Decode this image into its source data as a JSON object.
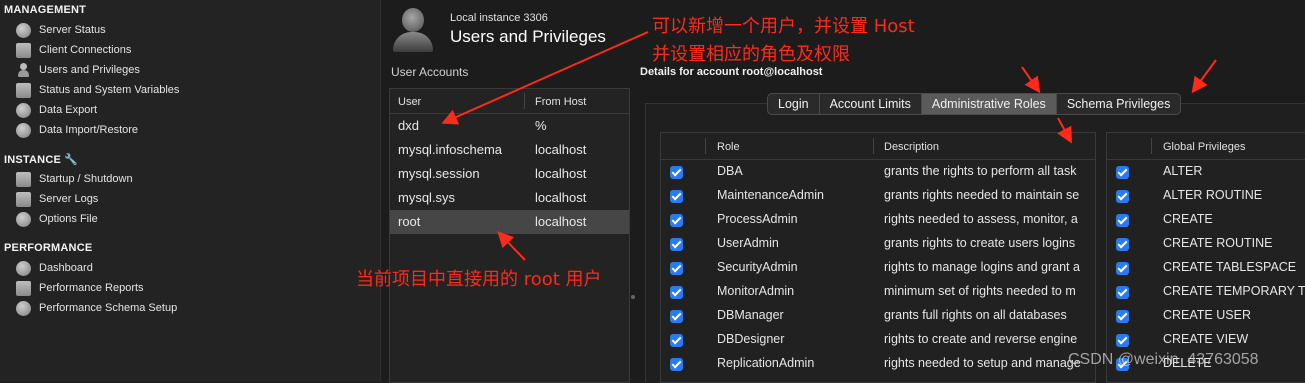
{
  "sidebar": {
    "management": {
      "heading": "MANAGEMENT",
      "items": [
        {
          "label": "Server Status",
          "icon": "server-status-icon"
        },
        {
          "label": "Client Connections",
          "icon": "client-connections-icon"
        },
        {
          "label": "Users and Privileges",
          "icon": "user-icon"
        },
        {
          "label": "Status and System Variables",
          "icon": "variables-icon"
        },
        {
          "label": "Data Export",
          "icon": "export-icon"
        },
        {
          "label": "Data Import/Restore",
          "icon": "import-icon"
        }
      ]
    },
    "instance": {
      "heading": "INSTANCE",
      "heading_icon": "wrench-icon",
      "items": [
        {
          "label": "Startup / Shutdown",
          "icon": "startup-icon"
        },
        {
          "label": "Server Logs",
          "icon": "logs-icon"
        },
        {
          "label": "Options File",
          "icon": "wrench-icon"
        }
      ]
    },
    "performance": {
      "heading": "PERFORMANCE",
      "items": [
        {
          "label": "Dashboard",
          "icon": "dashboard-icon"
        },
        {
          "label": "Performance Reports",
          "icon": "reports-icon"
        },
        {
          "label": "Performance Schema Setup",
          "icon": "schema-setup-icon"
        }
      ]
    }
  },
  "header": {
    "instance": "Local instance 3306",
    "title": "Users and Privileges"
  },
  "user_accounts": {
    "label": "User Accounts",
    "columns": [
      "User",
      "From Host"
    ],
    "rows": [
      {
        "user": "dxd",
        "host": "%"
      },
      {
        "user": "mysql.infoschema",
        "host": "localhost"
      },
      {
        "user": "mysql.session",
        "host": "localhost"
      },
      {
        "user": "mysql.sys",
        "host": "localhost"
      },
      {
        "user": "root",
        "host": "localhost",
        "selected": true
      }
    ]
  },
  "details": {
    "title": "Details for account root@localhost",
    "tabs": [
      "Login",
      "Account Limits",
      "Administrative Roles",
      "Schema Privileges"
    ],
    "active_tab": "Administrative Roles",
    "roles_columns": [
      "Role",
      "Description"
    ],
    "roles": [
      {
        "role": "DBA",
        "desc": "grants the rights to perform all task"
      },
      {
        "role": "MaintenanceAdmin",
        "desc": "grants rights needed to maintain se"
      },
      {
        "role": "ProcessAdmin",
        "desc": "rights needed to assess, monitor, a"
      },
      {
        "role": "UserAdmin",
        "desc": "grants rights to create users logins"
      },
      {
        "role": "SecurityAdmin",
        "desc": "rights to manage logins and grant a"
      },
      {
        "role": "MonitorAdmin",
        "desc": "minimum set of rights needed to m"
      },
      {
        "role": "DBManager",
        "desc": "grants full rights on all databases"
      },
      {
        "role": "DBDesigner",
        "desc": "rights to create and reverse engine"
      },
      {
        "role": "ReplicationAdmin",
        "desc": "rights needed to setup and manage"
      }
    ],
    "global_privileges_header": "Global Privileges",
    "global_privileges": [
      "ALTER",
      "ALTER ROUTINE",
      "CREATE",
      "CREATE ROUTINE",
      "CREATE TABLESPACE",
      "CREATE TEMPORARY T",
      "CREATE USER",
      "CREATE VIEW",
      "DELETE"
    ]
  },
  "annotations": {
    "top_line1": "可以新增一个用户，并设置 Host",
    "top_line2": "并设置相应的角色及权限",
    "bottom": "当前项目中直接用的 root 用户"
  },
  "watermark": "CSDN @weixin_43763058",
  "colors": {
    "annotation": "#ff2a1a",
    "checkbox": "#2b7bf0",
    "selected_row": "#464646"
  }
}
